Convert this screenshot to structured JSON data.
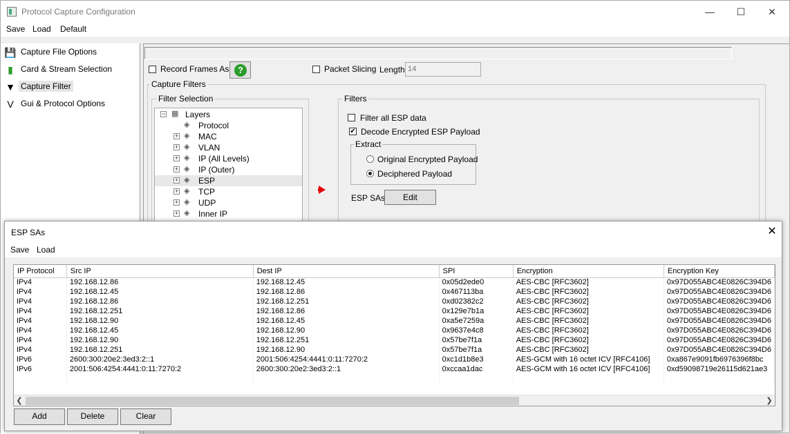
{
  "window": {
    "title": "Protocol Capture Configuration"
  },
  "icons": {
    "minimize": "minimize-icon",
    "maximize": "maximize-icon",
    "close": "close-icon",
    "help": "help-icon",
    "arrow": "red-arrow-icon"
  },
  "menu": {
    "save": "Save",
    "load": "Load",
    "default": "Default"
  },
  "sidebar": {
    "items": [
      {
        "label": "Capture File Options",
        "icon": "floppy-disk-icon"
      },
      {
        "label": "Card & Stream Selection",
        "icon": "card-icon"
      },
      {
        "label": "Capture Filter",
        "icon": "funnel-icon"
      },
      {
        "label": "Gui & Protocol Options",
        "icon": "gui-icon"
      }
    ]
  },
  "options": {
    "record_frames": "Record Frames As Is",
    "help_glyph": "?",
    "packet_slicing": "Packet Slicing",
    "length_label": "Length",
    "length_value": "14"
  },
  "capture_filters": {
    "title": "Capture Filters",
    "filter_selection": "Filter Selection",
    "tree": {
      "root": "Layers",
      "items": [
        "Protocol",
        "MAC",
        "VLAN",
        "IP (All Levels)",
        "IP (Outer)",
        "ESP",
        "TCP",
        "UDP",
        "Inner IP"
      ],
      "selected": "ESP"
    },
    "filters": {
      "title": "Filters",
      "filter_all_esp": "Filter all ESP data",
      "decode_encrypted": "Decode Encrypted ESP Payload",
      "extract_title": "Extract",
      "original_payload": "Original Encrypted Payload",
      "deciphered_payload": "Deciphered Payload",
      "esp_sas_label": "ESP SAs",
      "edit_button": "Edit"
    }
  },
  "dialog": {
    "title": "ESP SAs",
    "menu_save": "Save",
    "menu_load": "Load",
    "columns": [
      "IP Protocol",
      "Src IP",
      "Dest IP",
      "SPI",
      "Encryption",
      "Encryption Key"
    ],
    "rows": [
      [
        "IPv4",
        "192.168.12.86",
        "192.168.12.45",
        "0x05d2ede0",
        "AES-CBC [RFC3602]",
        "0x97D055ABC4E0826C394D6"
      ],
      [
        "IPv4",
        "192.168.12.45",
        "192.168.12.86",
        "0x467113ba",
        "AES-CBC [RFC3602]",
        "0x97D055ABC4E0826C394D6"
      ],
      [
        "IPv4",
        "192.168.12.86",
        "192.168.12.251",
        "0xd02382c2",
        "AES-CBC [RFC3602]",
        "0x97D055ABC4E0826C394D6"
      ],
      [
        "IPv4",
        "192.168.12.251",
        "192.168.12.86",
        "0x129e7b1a",
        "AES-CBC [RFC3602]",
        "0x97D055ABC4E0826C394D6"
      ],
      [
        "IPv4",
        "192.168.12.90",
        "192.168.12.45",
        "0xa5e7259a",
        "AES-CBC [RFC3602]",
        "0x97D055ABC4E0826C394D6"
      ],
      [
        "IPv4",
        "192.168.12.45",
        "192.168.12.90",
        "0x9637e4c8",
        "AES-CBC [RFC3602]",
        "0x97D055ABC4E0826C394D6"
      ],
      [
        "IPv4",
        "192.168.12.90",
        "192.168.12.251",
        "0x57be7f1a",
        "AES-CBC [RFC3602]",
        "0x97D055ABC4E0826C394D6"
      ],
      [
        "IPv4",
        "192.168.12.251",
        "192.168.12.90",
        "0x57be7f1a",
        "AES-CBC [RFC3602]",
        "0x97D055ABC4E0826C394D6"
      ],
      [
        "IPv6",
        "2600:300:20e2:3ed3:2::1",
        "2001:506:4254:4441:0:11:7270:2",
        "0xc1d1b8e3",
        "AES-GCM with 16 octet ICV [RFC4106]",
        "0xa867e9091fb6976396f8bc"
      ],
      [
        "IPv6",
        "2001:506:4254:4441:0:11:7270:2",
        "2600:300:20e2:3ed3:2::1",
        "0xccaa1dac",
        "AES-GCM with 16 octet ICV [RFC4106]",
        "0xd59098719e26115d621ae3"
      ]
    ],
    "buttons": {
      "add": "Add",
      "delete": "Delete",
      "clear": "Clear"
    }
  }
}
